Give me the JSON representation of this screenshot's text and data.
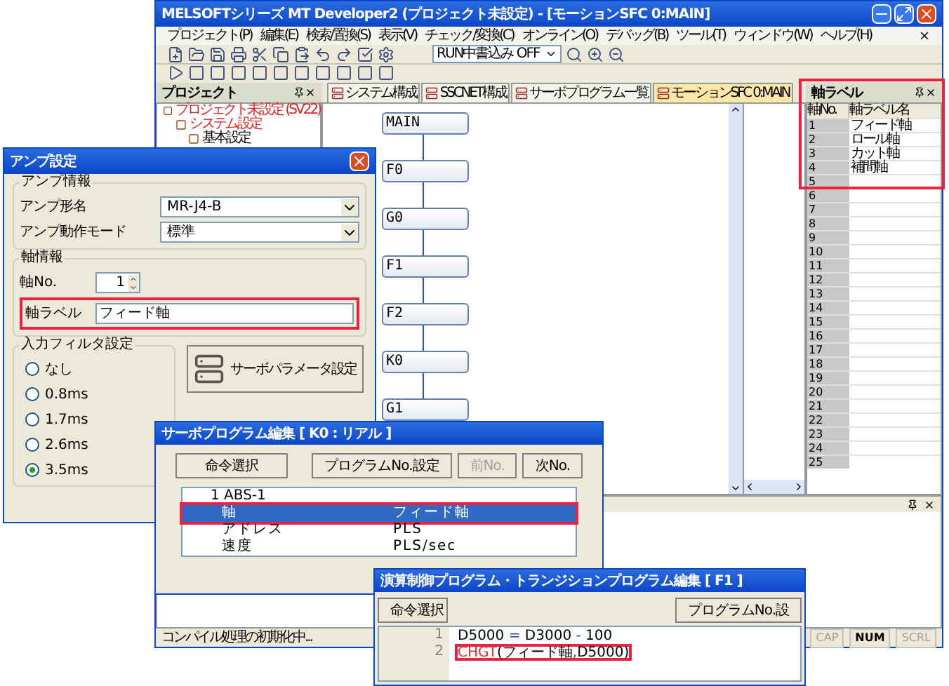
{
  "main_window": {
    "title": "MELSOFTシリーズ MT Developer2 (プロジェクト未設定) - [モーションSFC 0:MAIN]",
    "menu": [
      "プロジェクト(P)",
      "編集(E)",
      "検索/置換(S)",
      "表示(V)",
      "チェック/変換(C)",
      "オンライン(O)",
      "デバッグ(B)",
      "ツール(T)",
      "ウィンドウ(W)",
      "ヘルプ(H)"
    ],
    "run_mode_combo": "RUN中書込み OFF",
    "tabs": [
      {
        "label": "システム構成",
        "selected": false
      },
      {
        "label": "SSCNET構成",
        "selected": false
      },
      {
        "label": "サーボプログラム一覧",
        "selected": false
      },
      {
        "label": "モーションSFC 0:MAIN",
        "selected": true
      }
    ],
    "project_pane": {
      "title": "プロジェクト",
      "tree": [
        {
          "label": "プロジェクト未設定 (SV22)",
          "color": "#e02020",
          "children": [
            {
              "label": "システム設定",
              "color": "#e02020",
              "children": [
                {
                  "label": "基本設定",
                  "color": "#000000"
                }
              ]
            }
          ]
        }
      ]
    },
    "sfc_steps": [
      "MAIN",
      "F0",
      "G0",
      "F1",
      "F2",
      "K0",
      "G1"
    ],
    "axis_label_pane": {
      "title": "軸ラベル",
      "highlighted": true,
      "columns": [
        "軸No.",
        "軸ラベル名"
      ],
      "rows": [
        {
          "no": "1",
          "label": "フィード軸"
        },
        {
          "no": "2",
          "label": "ロール軸"
        },
        {
          "no": "3",
          "label": "カット軸"
        },
        {
          "no": "4",
          "label": "補間軸"
        },
        {
          "no": "5"
        },
        {
          "no": "6"
        },
        {
          "no": "7"
        },
        {
          "no": "8"
        },
        {
          "no": "9"
        },
        {
          "no": "10"
        },
        {
          "no": "11"
        },
        {
          "no": "12"
        },
        {
          "no": "13"
        },
        {
          "no": "14"
        },
        {
          "no": "15"
        },
        {
          "no": "16"
        },
        {
          "no": "17"
        },
        {
          "no": "18"
        },
        {
          "no": "19"
        },
        {
          "no": "20"
        },
        {
          "no": "21"
        },
        {
          "no": "22"
        },
        {
          "no": "23"
        },
        {
          "no": "24"
        },
        {
          "no": "25"
        }
      ]
    },
    "status_bar": {
      "message": "コンパイル処理の初期化中...",
      "indicators": [
        {
          "label": "CAP",
          "on": false
        },
        {
          "label": "NUM",
          "on": true
        },
        {
          "label": "SCRL",
          "on": false
        }
      ]
    }
  },
  "amp_dialog": {
    "title": "アンプ設定",
    "amp_info": {
      "title": "アンプ情報",
      "fields": [
        {
          "label": "アンプ形名",
          "value": "MR-J4-B"
        },
        {
          "label": "アンプ動作モード",
          "value": "標準"
        }
      ]
    },
    "axis_info": {
      "title": "軸情報",
      "axis_no_label": "軸No.",
      "axis_no": "1",
      "axis_label_label": "軸ラベル",
      "axis_label": "フィード軸",
      "highlighted": true
    },
    "input_filter": {
      "title": "入力フィルタ設定",
      "options": [
        {
          "label": "なし",
          "selected": false
        },
        {
          "label": "0.8ms",
          "selected": false
        },
        {
          "label": "1.7ms",
          "selected": false
        },
        {
          "label": "2.6ms",
          "selected": false
        },
        {
          "label": "3.5ms",
          "selected": true
        }
      ]
    },
    "servo_param_button": "サーボパラメータ設定"
  },
  "servo_dialog": {
    "title": "サーボプログラム編集 [ K0 : リアル ]",
    "buttons": [
      {
        "label": "命令選択",
        "disabled": false
      },
      {
        "label": "プログラムNo.設定",
        "disabled": false
      },
      {
        "label": "前No.",
        "disabled": true
      },
      {
        "label": "次No.",
        "disabled": false
      }
    ],
    "rows": [
      {
        "kind": "header",
        "item": "1 ABS-1",
        "selected": false,
        "highlighted": false
      },
      {
        "kind": "param",
        "item": "軸",
        "value": "フィード軸",
        "selected": true,
        "highlighted": true
      },
      {
        "kind": "param",
        "item": "アドレス",
        "value": "PLS",
        "selected": false,
        "highlighted": false
      },
      {
        "kind": "param",
        "item": "速度",
        "value": "PLS/sec",
        "selected": false,
        "highlighted": false
      }
    ]
  },
  "transition_dialog": {
    "title": "演算制御プログラム・トランジションプログラム編集 [ F1 ]",
    "buttons": [
      "命令選択",
      "プログラムNo.設"
    ],
    "lines": [
      {
        "number": "1",
        "highlighted": false,
        "tokens": [
          {
            "text": "D5000",
            "kind": "plain"
          },
          {
            "text": " = ",
            "kind": "operator"
          },
          {
            "text": "D3000",
            "kind": "plain"
          },
          {
            "text": " - ",
            "kind": "operator"
          },
          {
            "text": "100",
            "kind": "plain"
          }
        ]
      },
      {
        "number": "2",
        "highlighted": true,
        "tokens": [
          {
            "text": "CHGT",
            "kind": "function"
          },
          {
            "text": "(フィード軸",
            "kind": "plain"
          },
          {
            "text": ",",
            "kind": "operator"
          },
          {
            "text": "D5000)",
            "kind": "plain"
          }
        ]
      }
    ]
  }
}
